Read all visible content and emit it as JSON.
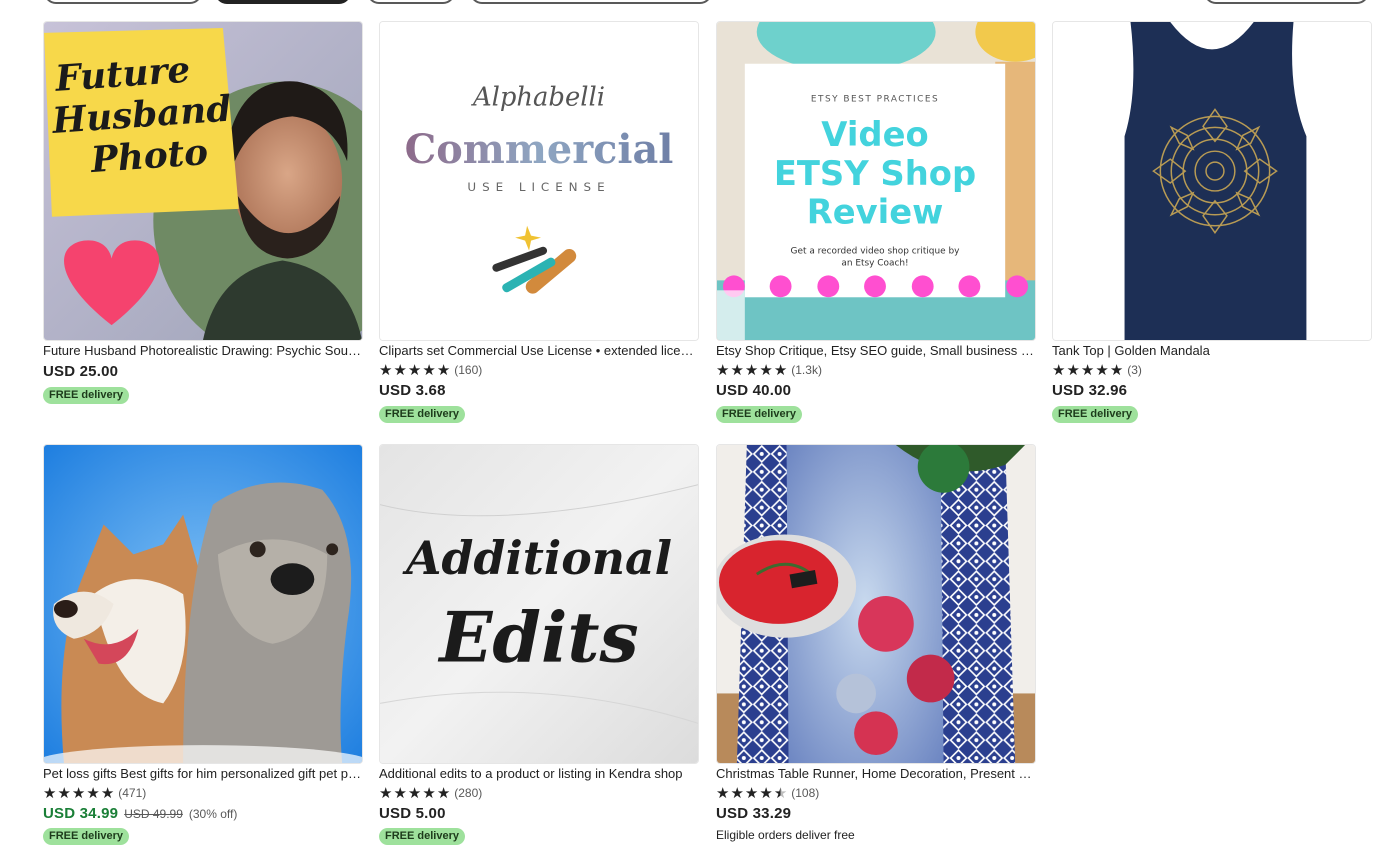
{
  "listings": [
    {
      "title": "Future Husband Photorealistic Drawing: Psychic Soulmate Portrait",
      "image_text": [
        "Future",
        "Husband",
        "Photo"
      ],
      "price": "USD 25.00",
      "badge": "FREE delivery"
    },
    {
      "title": "Cliparts set Commercial Use License • extended license",
      "image_text": [
        "Alphabelli",
        "Commercial",
        "USE LICENSE"
      ],
      "rating_count": "(160)",
      "price": "USD 3.68",
      "badge": "FREE delivery"
    },
    {
      "title": "Etsy Shop Critique, Etsy SEO guide, Small business help",
      "image_text": [
        "ETSY BEST PRACTICES",
        "Video",
        "ETSY Shop",
        "Review",
        "Get a recorded video shop critique by",
        "an Etsy Coach!"
      ],
      "rating_count": "(1.3k)",
      "price": "USD 40.00",
      "badge": "FREE delivery"
    },
    {
      "title": "Tank Top | Golden Mandala",
      "rating_count": "(3)",
      "price": "USD 32.96",
      "badge": "FREE delivery"
    },
    {
      "title": "Pet loss gifts Best gifts for him personalized gift pet portrait",
      "rating_count": "(471)",
      "price": "USD 34.99",
      "original_price": "USD 49.99",
      "discount": "(30% off)",
      "badge": "FREE delivery"
    },
    {
      "title": "Additional edits to a product or listing in Kendra shop",
      "image_text": [
        "Additional",
        "Edits"
      ],
      "rating_count": "(280)",
      "price": "USD 5.00",
      "badge": "FREE delivery"
    },
    {
      "title": "Christmas Table Runner, Home Decoration, Present for her",
      "rating_count": "(108)",
      "rating": 4.5,
      "price": "USD 33.29",
      "delivery_note": "Eligible orders deliver free"
    }
  ],
  "icons": {
    "star": "star-icon",
    "half_star": "half-star-icon"
  },
  "colors": {
    "free_badge": "#9ee19c",
    "sale_price": "#1a7f37"
  }
}
